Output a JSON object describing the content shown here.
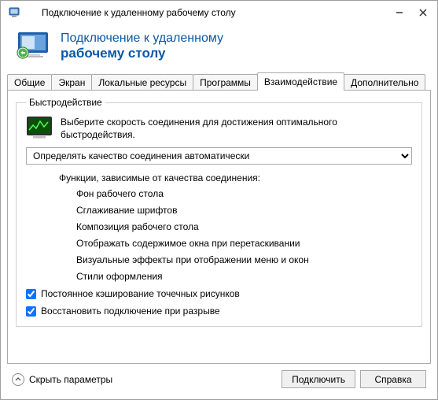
{
  "window": {
    "title": "Подключение к удаленному рабочему столу"
  },
  "header": {
    "line1": "Подключение к удаленному",
    "line2": "рабочему столу"
  },
  "tabs": [
    {
      "label": "Общие"
    },
    {
      "label": "Экран"
    },
    {
      "label": "Локальные ресурсы"
    },
    {
      "label": "Программы"
    },
    {
      "label": "Взаимодействие"
    },
    {
      "label": "Дополнительно"
    }
  ],
  "active_tab_index": 4,
  "performance": {
    "group_title": "Быстродействие",
    "instruction": "Выберите скорость соединения для достижения оптимального быстродействия.",
    "combo_selected": "Определять качество соединения автоматически",
    "features_label": "Функции, зависимые от качества соединения:",
    "features": [
      "Фон рабочего стола",
      "Сглаживание шрифтов",
      "Композиция рабочего стола",
      "Отображать содержимое окна при перетаскивании",
      "Визуальные эффекты при отображении меню и окон",
      "Стили оформления"
    ],
    "cache_bitmaps_label": "Постоянное кэширование точечных рисунков",
    "cache_bitmaps_checked": true,
    "reconnect_label": "Восстановить подключение при разрыве",
    "reconnect_checked": true
  },
  "bottom": {
    "hide_params": "Скрыть параметры",
    "connect": "Подключить",
    "help": "Справка"
  }
}
